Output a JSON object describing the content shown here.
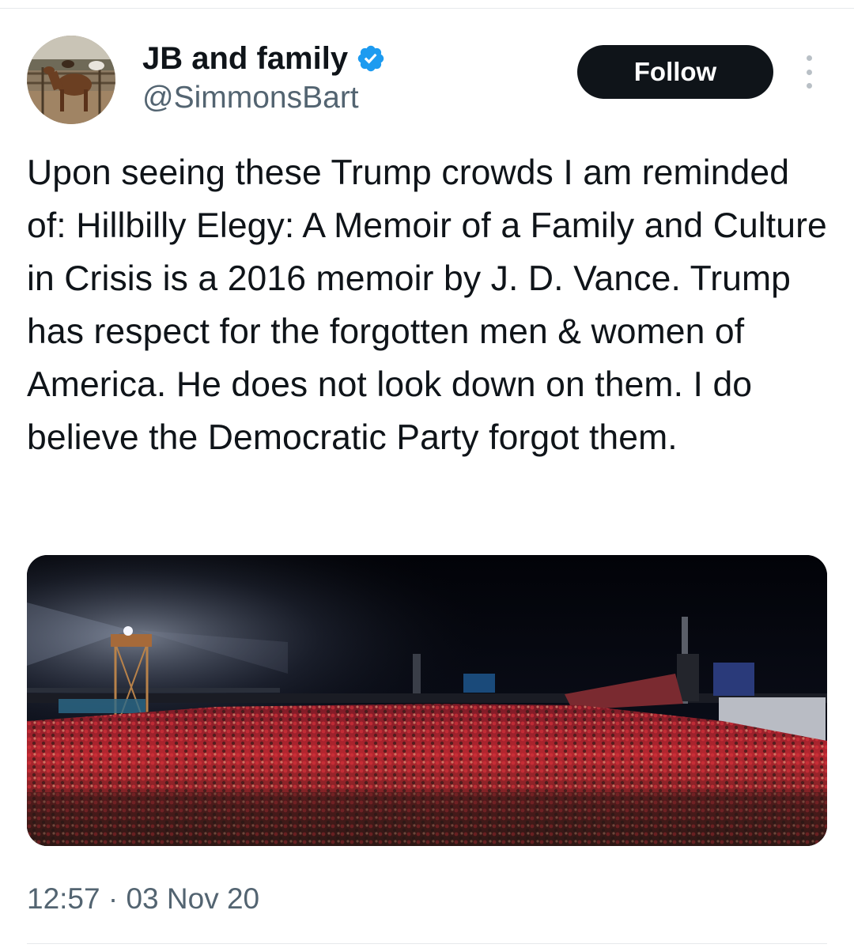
{
  "tweet": {
    "author": {
      "display_name": "JB and family",
      "handle": "@SimmonsBart",
      "verified_icon": "verified-badge-icon",
      "avatar_icon": "avatar-horses-corral"
    },
    "follow_label": "Follow",
    "more_icon": "more-vertical-icon",
    "text": "Upon seeing these Trump crowds I am reminded of: Hillbilly Elegy: A Memoir of a Family and Culture in Crisis is a 2016 memoir by J. D. Vance. Trump has respect for the forgotten men & women of America. He does not look down on them. I do believe the Democratic Party forgot them.",
    "timestamp": "12:57 · 03 Nov 20"
  },
  "colors": {
    "text_primary": "#0f1419",
    "text_secondary": "#536471",
    "verified_blue": "#1d9bf0",
    "follow_bg": "#0f1419",
    "follow_text": "#ffffff",
    "crowd_red": "#c8283a"
  }
}
